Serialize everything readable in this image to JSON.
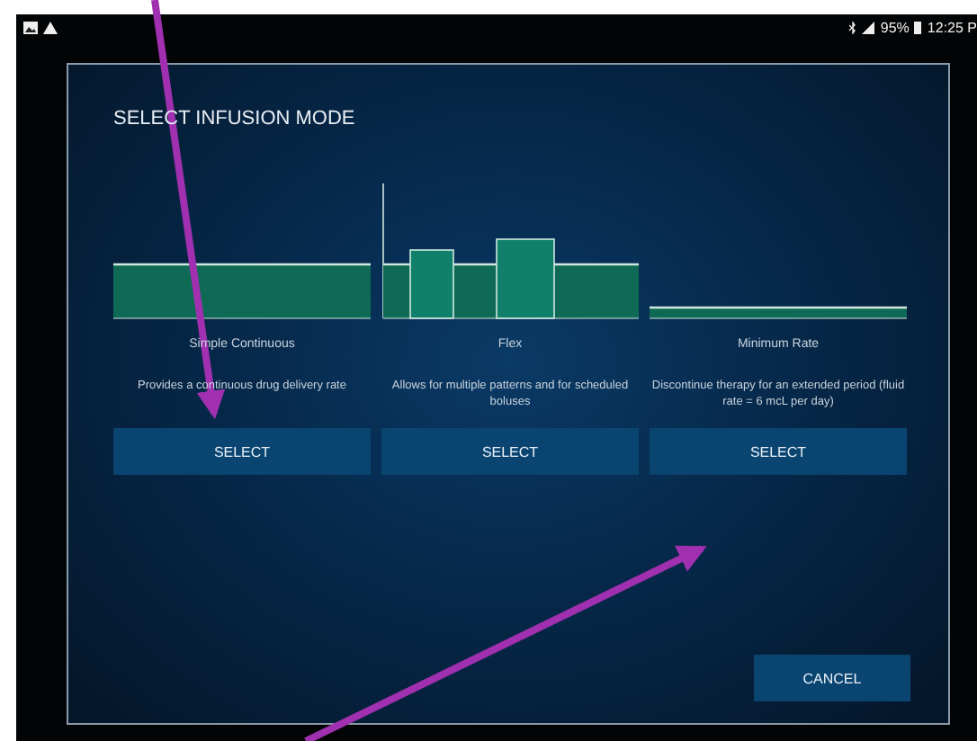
{
  "status_bar": {
    "battery": "95%",
    "time": "12:25 P"
  },
  "dialog": {
    "title": "SELECT INFUSION MODE",
    "modes": [
      {
        "kind": "continuous",
        "name": "Simple Continuous",
        "description": "Provides a continuous drug delivery rate",
        "button": "SELECT"
      },
      {
        "kind": "flex",
        "name": "Flex",
        "description": "Allows for multiple patterns and for scheduled boluses",
        "button": "SELECT"
      },
      {
        "kind": "minimum",
        "name": "Minimum Rate",
        "description": "Discontinue therapy for an extended period (fluid rate = 6 mcL per day)",
        "button": "SELECT"
      }
    ],
    "cancel": "CANCEL"
  }
}
